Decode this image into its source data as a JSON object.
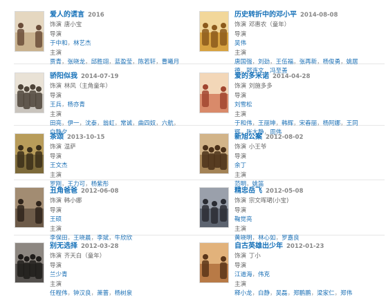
{
  "labels": {
    "role": "饰演",
    "director": "导演",
    "cast": "主演"
  },
  "cards": [
    {
      "title": "爱人的谎言",
      "date": "2016",
      "role": "唐小宝",
      "directors": [
        "于中和",
        "林艺杰"
      ],
      "cast": [
        "贾青",
        "张晓龙",
        "邱胜翊",
        "蓝盈莹",
        "陈若轩",
        "曹曦月"
      ],
      "poster_colors": [
        "#c9b28f",
        "#6b4d3a",
        "#e5d7c0"
      ]
    },
    {
      "title": "历史转折中的邓小平",
      "date": "2014-08-08",
      "role": "邓惠农（童年）",
      "directors": [
        "吴伟"
      ],
      "cast": [
        "唐国强",
        "刘劲",
        "王伍福",
        "张再新",
        "杨俊勇",
        "姚居德",
        "郭连文",
        "冯至善"
      ],
      "poster_colors": [
        "#d7a241",
        "#8c5a1c",
        "#f2d79a"
      ]
    },
    {
      "title": "骄阳似我",
      "date": "2014-07-19",
      "role": "林风（主角童年）",
      "directors": [
        "王兵",
        "杨亦青"
      ],
      "cast": [
        "田亮",
        "伊一",
        "沈泰",
        "翁虹",
        "常诚",
        "曲四奴",
        "六航",
        "白静夕"
      ],
      "poster_colors": [
        "#c9c4bd",
        "#4e4439",
        "#e9e2d6"
      ]
    },
    {
      "title": "爱的多米诺",
      "date": "2014-04-28",
      "role": "刘施多多",
      "directors": [
        "刘雪松"
      ],
      "cast": [
        "于和伟",
        "王丽坤",
        "韩辉",
        "宋春丽",
        "杨阿娜",
        "王同辉",
        "张大静",
        "周伟"
      ],
      "poster_colors": [
        "#d98a6a",
        "#a1452f",
        "#f3d7b8"
      ]
    },
    {
      "title": "茶颂",
      "date": "2013-10-15",
      "role": "温萨",
      "directors": [
        "王文杰"
      ],
      "cast": [
        "罗刚",
        "王力可",
        "杨紫彤"
      ],
      "poster_colors": [
        "#7d6a3a",
        "#3b2f1a",
        "#b89c5a"
      ]
    },
    {
      "title": "新旭公案",
      "date": "2012-08-02",
      "role": "小王爷",
      "directors": [
        "余丁"
      ],
      "cast": [
        "范明",
        "姚笛"
      ],
      "poster_colors": [
        "#a48356",
        "#4a3018",
        "#d2b489"
      ]
    },
    {
      "title": "丑角爸爸",
      "date": "2012-06-08",
      "role": "韩小娜",
      "directors": [
        "王硕"
      ],
      "cast": [
        "李保田",
        "王晓晨",
        "李斌",
        "牛欣欣"
      ],
      "poster_colors": [
        "#6d5b49",
        "#2f241b",
        "#a28c72"
      ]
    },
    {
      "title": "精忠岳飞",
      "date": "2012-05-08",
      "role": "宗文晖珺(小宝)",
      "directors": [
        "鞠觉亮"
      ],
      "cast": [
        "黄晓明",
        "林心如",
        "罗嘉良"
      ],
      "poster_colors": [
        "#5d6470",
        "#2a2c33",
        "#9aa0ab"
      ]
    },
    {
      "title": "别无选择",
      "date": "2012-03-28",
      "role": "齐天白（童年）",
      "directors": [
        "兰少青"
      ],
      "cast": [
        "任程伟",
        "钟汉良",
        "萧蔷",
        "杨树泉"
      ],
      "poster_colors": [
        "#54504d",
        "#1f1c1a",
        "#8d8781"
      ]
    },
    {
      "title": "自古英雄出少年",
      "date": "2012-01-23",
      "role": "丁小",
      "directors": [
        "江道海",
        "伟克"
      ],
      "cast": [
        "释小龙",
        "白静",
        "吴磊",
        "郑鹏鹏",
        "梁家仁",
        "郑伟"
      ],
      "poster_colors": [
        "#b87a46",
        "#5a3519",
        "#e2b27b"
      ]
    }
  ]
}
